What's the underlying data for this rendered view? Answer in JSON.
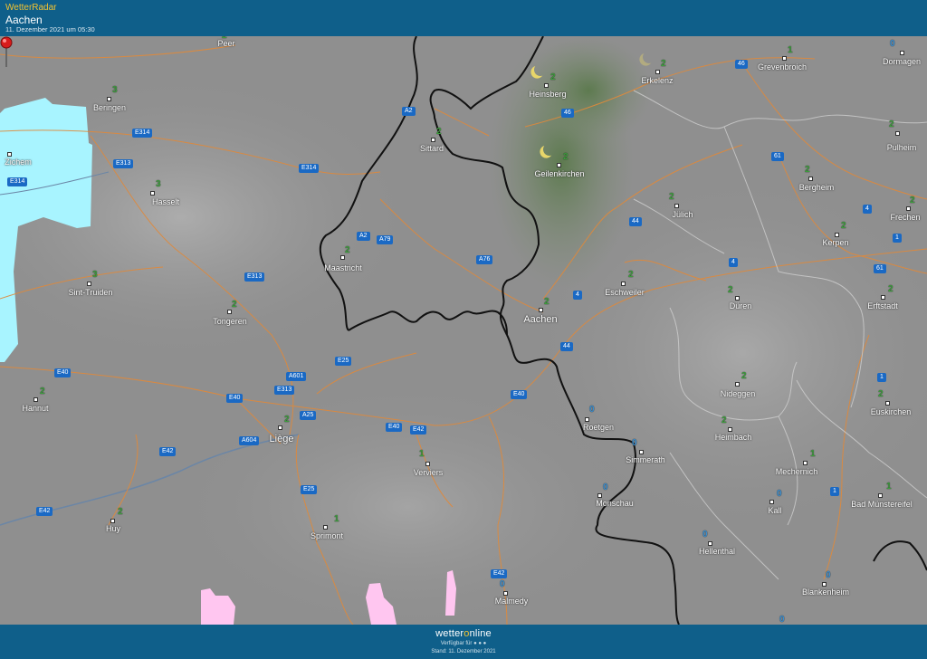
{
  "header": {
    "brand": "WetterRadar",
    "location": "Aachen",
    "timestamp": "11. Dezember 2021 um 05:30"
  },
  "footer": {
    "logo_a": "wetter",
    "logo_b": "o",
    "logo_c": "nline",
    "available": "Verfügbar für",
    "stand": "Stand: 11. Dezember 2021"
  },
  "cities": {
    "peer": "Peer",
    "beringen": "Beringen",
    "zichem": "Zichem",
    "hasselt": "Hasselt",
    "sittard": "Sittard",
    "heinsberg": "Heinsberg",
    "erkelenz": "Erkelenz",
    "grevenbroich": "Grevenbroich",
    "dormagen": "Dormagen",
    "geilenkirchen": "Geilenkirchen",
    "julich": "Jülich",
    "bergheim": "Bergheim",
    "pulheim": "Pulheim",
    "frechen": "Frechen",
    "kerpen": "Kerpen",
    "maastricht": "Maastricht",
    "sinttruiden": "Sint-Truiden",
    "tongeren": "Tongeren",
    "aachen": "Aachen",
    "eschweiler": "Eschweiler",
    "duren": "Düren",
    "erftstadt": "Erftstadt",
    "nideggen": "Nideggen",
    "hannut": "Hannut",
    "liege": "Liège",
    "roetgen": "Roetgen",
    "euskirchen": "Euskirchen",
    "heimbach": "Heimbach",
    "verviers": "Verviers",
    "simmerath": "Simmerath",
    "mechernich": "Mechernich",
    "monschau": "Monschau",
    "kall": "Kall",
    "badmunstereifel": "Bad Münstereifel",
    "huy": "Huy",
    "sprimont": "Sprimont",
    "hellenthal": "Hellenthal",
    "malmedy": "Malmedy",
    "blankenheim": "Blankenheim"
  },
  "roads": {
    "a2_top": "A2",
    "e314_a": "E314",
    "e313_a": "E313",
    "e314_b": "E314",
    "e314_c": "E314",
    "a46": "46",
    "r46": "46",
    "r61": "61",
    "r44": "44",
    "r4a": "4",
    "r4b": "4",
    "r1": "1",
    "r61b": "61",
    "a2_mid": "A2",
    "a79": "A79",
    "a76": "A76",
    "e313_b": "E313",
    "r4c": "4",
    "r44b": "44",
    "e40_a": "E40",
    "e25_a": "E25",
    "a601": "A601",
    "e40_b": "E40",
    "e313_c": "E313",
    "a25": "A25",
    "e40_c": "E40",
    "e42_a": "E42",
    "e40_d": "E40",
    "e42_b": "E42",
    "a604": "A604",
    "e42_c": "E42",
    "r1b": "1",
    "e25_b": "E25",
    "r1c": "1",
    "e42_d": "E42"
  },
  "weather": {
    "peer": "2",
    "beringen": "3",
    "hasselt": "3",
    "sittard": "2",
    "heinsberg": "2",
    "erkelenz": "2",
    "grevenbroich": "1",
    "dormagen": "0",
    "geilenkirchen": "2",
    "julich": "2",
    "bergheim": "2",
    "pulheim": "2",
    "frechen": "2",
    "kerpen": "2",
    "maastricht": "2",
    "sinttruiden": "3",
    "tongeren": "2",
    "aachen": "2",
    "eschweiler": "2",
    "duren": "2",
    "erftstadt": "2",
    "nideggen": "2",
    "hannut": "2",
    "liege": "2",
    "roetgen": "0",
    "euskirchen": "2",
    "heimbach": "2",
    "verviers": "1",
    "simmerath": "0",
    "mechernich": "1",
    "monschau": "0",
    "kall": "0",
    "badmunstereifel": "1",
    "huy": "2",
    "sprimont": "1",
    "hellenthal": "0",
    "malmedy": "0",
    "blankenheim": "0",
    "bottom": "0"
  },
  "colors": {
    "header_bg": "#0f5f8a",
    "brand": "#f2c230",
    "precip_light": "#a8f4ff",
    "precip_snow": "#ffc6f0",
    "road": "#e8913c",
    "border": "#111111"
  }
}
